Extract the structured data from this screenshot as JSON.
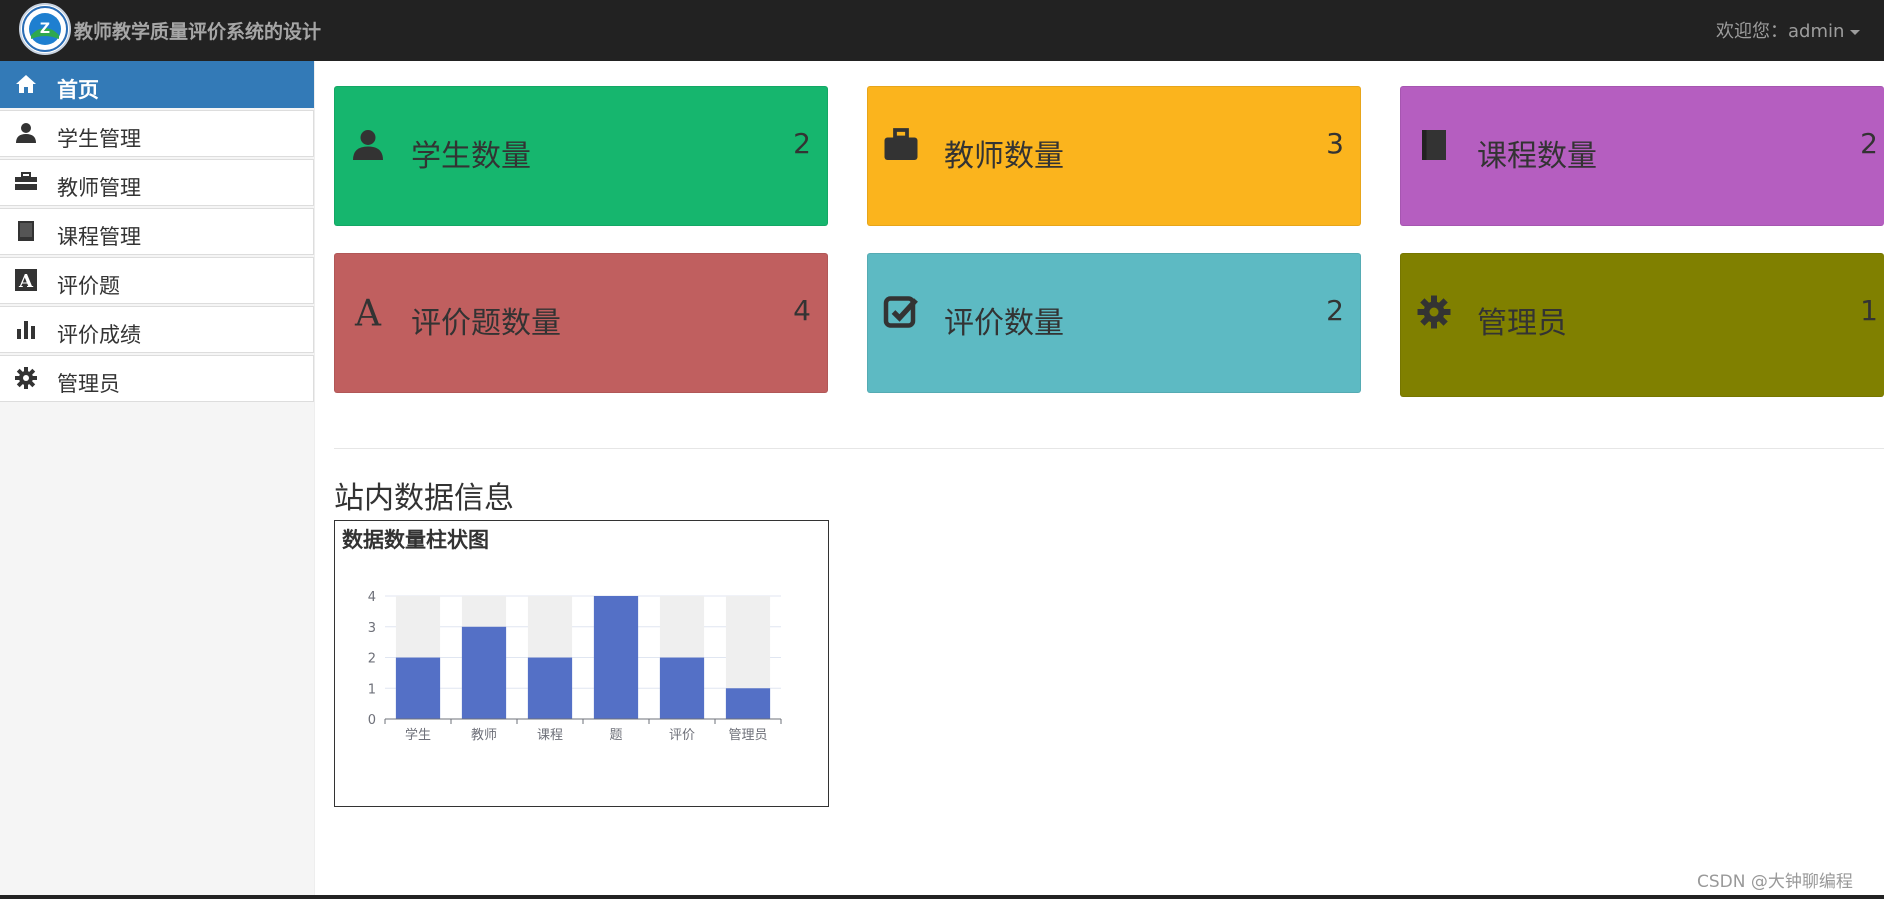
{
  "header": {
    "brand": "教师教学质量评价系统的设计",
    "welcome": "欢迎您：admin",
    "logo_icon": "school-logo-icon"
  },
  "sidebar": {
    "items": [
      {
        "label": "首页",
        "icon": "home-icon",
        "active": true
      },
      {
        "label": "学生管理",
        "icon": "user-icon"
      },
      {
        "label": "教师管理",
        "icon": "briefcase-icon"
      },
      {
        "label": "课程管理",
        "icon": "book-icon"
      },
      {
        "label": "评价题",
        "icon": "font-icon"
      },
      {
        "label": "评价成绩",
        "icon": "bar-chart-icon"
      },
      {
        "label": "管理员",
        "icon": "gear-icon"
      }
    ],
    "active_color": "#337ab7"
  },
  "cards": [
    {
      "label": "学生数量",
      "value": "2",
      "icon": "user-icon",
      "color": "#16b66e"
    },
    {
      "label": "教师数量",
      "value": "3",
      "icon": "briefcase-icon",
      "color": "#fbb41d"
    },
    {
      "label": "课程数量",
      "value": "2",
      "icon": "book-icon",
      "color": "#b55ec0"
    },
    {
      "label": "评价题数量",
      "value": "4",
      "icon": "font-icon",
      "color": "#c05f5f"
    },
    {
      "label": "评价数量",
      "value": "2",
      "icon": "check-square-icon",
      "color": "#5dbac3"
    },
    {
      "label": "管理员",
      "value": "1",
      "icon": "gear-icon",
      "color": "#808000"
    }
  ],
  "section": {
    "title": "站内数据信息"
  },
  "chart_data": {
    "type": "bar",
    "title": "数据数量柱状图",
    "categories": [
      "学生",
      "教师",
      "课程",
      "题",
      "评价",
      "管理员"
    ],
    "values": [
      2,
      3,
      2,
      4,
      2,
      1
    ],
    "ylim": [
      0,
      4
    ],
    "yticks": [
      "0",
      "1",
      "2",
      "3",
      "4"
    ],
    "bar_color": "#5470c6",
    "background_bar_color": "#efefef",
    "grid": true
  },
  "watermark": "CSDN @大钟聊编程"
}
